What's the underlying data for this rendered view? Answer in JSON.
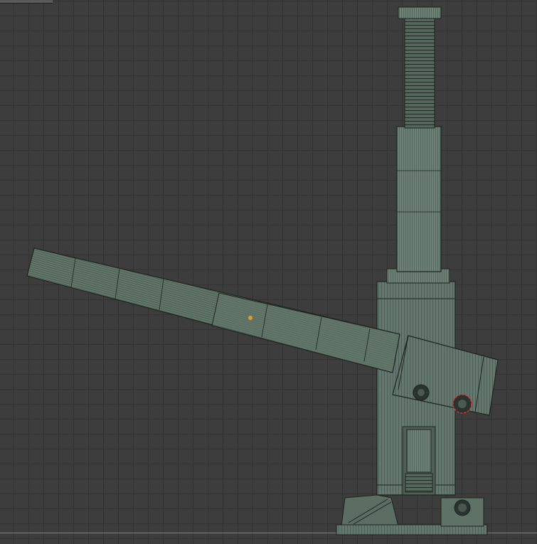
{
  "viewport": {
    "mode": "orthographic-wireframe-overlay",
    "grid_visible": true,
    "colors": {
      "background": "#3d3d3d",
      "grid_minor": "#333333",
      "grid_major": "#2c2c2c",
      "ground_axis": "#7a9a3a",
      "mesh_fill": "#5f7268",
      "mesh_fill_light": "#6f8378",
      "mesh_fill_dark": "#4a5a52",
      "wire": "#1c2420",
      "origin": "#e59b2a",
      "selection": "#e0303a"
    }
  },
  "object": {
    "name_icon": "bottle-jack-mesh",
    "parts": [
      "screw-cap",
      "threaded-screw",
      "ram",
      "cylinder",
      "handle-socket",
      "handle-tube",
      "pump-plunger",
      "base"
    ]
  }
}
